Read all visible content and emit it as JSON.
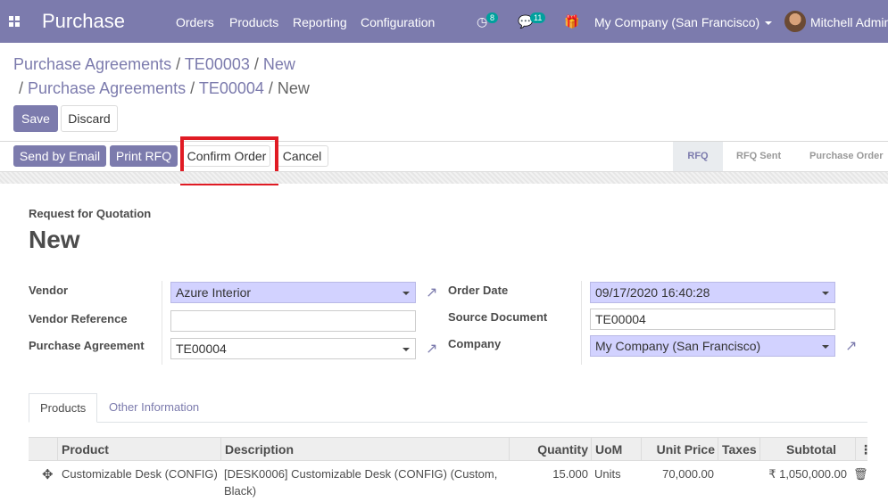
{
  "navbar": {
    "app_name": "Purchase",
    "menu": [
      "Orders",
      "Products",
      "Reporting",
      "Configuration"
    ],
    "activity_count": "8",
    "message_count": "11",
    "company": "My Company (San Francisco)",
    "user": "Mitchell Admin",
    "color": "#7c7bad"
  },
  "breadcrumb": {
    "line1": [
      "Purchase Agreements",
      "TE00003",
      "New"
    ],
    "line2": [
      "Purchase Agreements",
      "TE00004",
      "New"
    ]
  },
  "controls": {
    "save": "Save",
    "discard": "Discard"
  },
  "actions": {
    "send_email": "Send by Email",
    "print_rfq": "Print RFQ",
    "confirm_order": "Confirm Order",
    "cancel": "Cancel"
  },
  "stages": [
    "RFQ",
    "RFQ Sent",
    "Purchase Order"
  ],
  "form": {
    "subtitle": "Request for Quotation",
    "title": "New",
    "vendor_label": "Vendor",
    "vendor_value": "Azure Interior",
    "vendor_ref_label": "Vendor Reference",
    "vendor_ref_value": "",
    "agreement_label": "Purchase Agreement",
    "agreement_value": "TE00004",
    "order_date_label": "Order Date",
    "order_date_value": "09/17/2020 16:40:28",
    "source_doc_label": "Source Document",
    "source_doc_value": "TE00004",
    "company_label": "Company",
    "company_value": "My Company (San Francisco)"
  },
  "tabs": [
    "Products",
    "Other Information"
  ],
  "table": {
    "headers": [
      "Product",
      "Description",
      "Quantity",
      "UoM",
      "Unit Price",
      "Taxes",
      "Subtotal"
    ],
    "row": {
      "product": "Customizable Desk (CONFIG)",
      "description_1": "[DESK0006] Customizable Desk (CONFIG) (Custom,",
      "description_2": "Black)",
      "quantity": "15.000",
      "uom": "Units",
      "unit_price": "70,000.00",
      "taxes": "",
      "subtotal": "₹ 1,050,000.00"
    }
  }
}
